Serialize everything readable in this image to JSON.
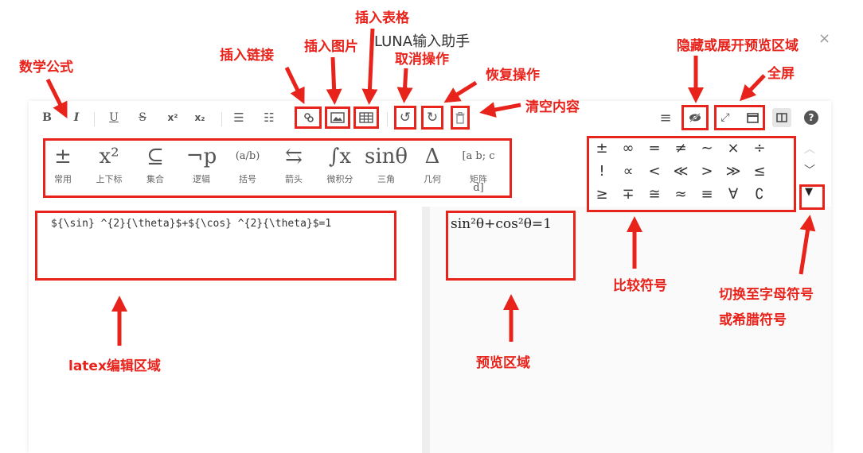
{
  "window": {
    "title": "LUNA输入助手",
    "close_icon": "close-icon"
  },
  "toolbar": {
    "bold": "B",
    "italic": "I",
    "underline": "U",
    "strikethrough": "S",
    "superscript": "x²",
    "subscript": "x₂",
    "ordered_list": "☰",
    "unordered_list": "☷",
    "link": "link-icon",
    "image": "image-icon",
    "table": "table-icon",
    "undo": "undo-icon",
    "redo": "redo-icon",
    "clear": "trash-icon",
    "menu": "≡",
    "hide_preview": "eye-slash-icon",
    "fullscreen": "expand-icon",
    "window_mode": "window-icon",
    "split_view": "split-icon",
    "help": "?"
  },
  "categories": [
    {
      "symbol": "±",
      "label": "常用"
    },
    {
      "symbol": "x²",
      "label": "上下标"
    },
    {
      "symbol": "⊆",
      "label": "集合"
    },
    {
      "symbol": "¬p",
      "label": "逻辑"
    },
    {
      "symbol": "(a/b)",
      "label": "括号"
    },
    {
      "symbol": "⇆",
      "label": "箭头"
    },
    {
      "symbol": "∫x",
      "label": "微积分"
    },
    {
      "symbol": "sinθ",
      "label": "三角"
    },
    {
      "symbol": "Δ",
      "label": "几何"
    },
    {
      "symbol": "[a b; c d]",
      "label": "矩阵"
    }
  ],
  "symbols": [
    [
      "±",
      "∞",
      "=",
      "≠",
      "~",
      "×",
      "÷"
    ],
    [
      "!",
      "∝",
      "<",
      "≪",
      ">",
      "≫",
      "≤"
    ],
    [
      "≥",
      "∓",
      "≅",
      "≈",
      "≡",
      "∀",
      "∁"
    ]
  ],
  "editor": {
    "latex": "${\\sin} ^{2}{\\theta}$+${\\cos} ^{2}{\\theta}$=1",
    "preview": "sin²θ+cos²θ=1"
  },
  "annotations": {
    "math_formula": "数学公式",
    "insert_link": "插入链接",
    "insert_image": "插入图片",
    "insert_table": "插入表格",
    "undo": "取消操作",
    "redo": "恢复操作",
    "clear": "清空内容",
    "toggle_preview": "隐藏或展开预览区域",
    "fullscreen": "全屏",
    "compare_symbols": "比较符号",
    "switch_letters_1": "切换至字母符号",
    "switch_letters_2": "或希腊符号",
    "latex_area": "latex编辑区域",
    "preview_area": "预览区域"
  },
  "colors": {
    "annotation": "#e8231b",
    "toolbar_text": "#555555"
  }
}
